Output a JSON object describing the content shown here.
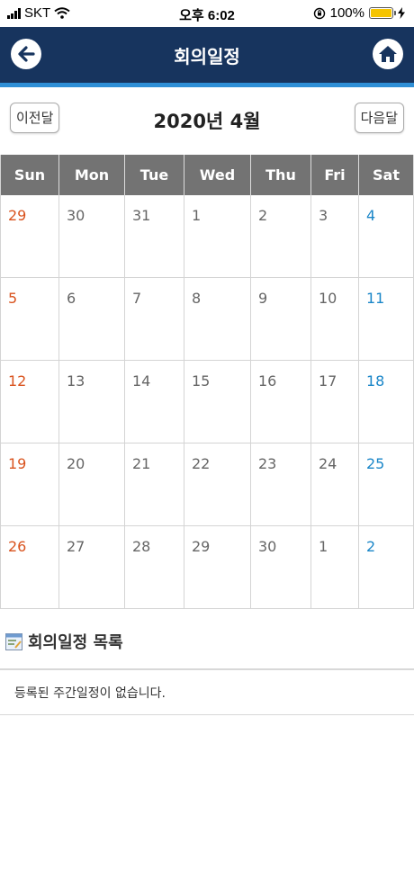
{
  "status_bar": {
    "carrier": "SKT",
    "time": "오후 6:02",
    "battery": "100%"
  },
  "header": {
    "title": "회의일정",
    "back_icon": "left-arrow-icon",
    "home_icon": "home-icon"
  },
  "calendar": {
    "prev_label": "이전달",
    "next_label": "다음달",
    "month_title": "2020년 4월",
    "weekdays": [
      "Sun",
      "Mon",
      "Tue",
      "Wed",
      "Thu",
      "Fri",
      "Sat"
    ],
    "weeks": [
      [
        "29",
        "30",
        "31",
        "1",
        "2",
        "3",
        "4"
      ],
      [
        "5",
        "6",
        "7",
        "8",
        "9",
        "10",
        "11"
      ],
      [
        "12",
        "13",
        "14",
        "15",
        "16",
        "17",
        "18"
      ],
      [
        "19",
        "20",
        "21",
        "22",
        "23",
        "24",
        "25"
      ],
      [
        "26",
        "27",
        "28",
        "29",
        "30",
        "1",
        "2"
      ]
    ],
    "colors": {
      "sunday": "#d9531e",
      "saturday": "#1a86c8",
      "header_bg": "#737373"
    }
  },
  "schedule_list": {
    "title": "회의일정 목록",
    "empty_message": "등록된 주간일정이 없습니다."
  },
  "colors": {
    "header_bg": "#17345e",
    "accent": "#2f8fd6"
  }
}
